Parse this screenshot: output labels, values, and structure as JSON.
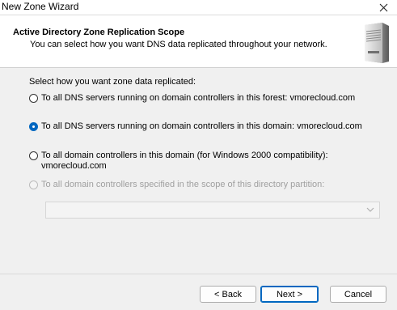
{
  "window": {
    "title": "New Zone Wizard"
  },
  "header": {
    "title": "Active Directory Zone Replication Scope",
    "subtitle": "You can select how you want DNS data replicated throughout your network.",
    "icon": "server-icon"
  },
  "body": {
    "prompt": "Select how you want zone data replicated:",
    "options": [
      {
        "label": "To all DNS servers running on domain controllers in this forest: vmorecloud.com",
        "selected": false,
        "enabled": true
      },
      {
        "label": "To all DNS servers running on domain controllers in this domain: vmorecloud.com",
        "selected": true,
        "enabled": true
      },
      {
        "label_line1": "To all domain controllers in this domain (for Windows 2000 compatibility):",
        "label_line2": "vmorecloud.com",
        "selected": false,
        "enabled": true
      },
      {
        "label": "To all domain controllers specified in the scope of this directory partition:",
        "selected": false,
        "enabled": false
      }
    ],
    "partition_select": {
      "value": "",
      "enabled": false
    }
  },
  "buttons": {
    "back": "< Back",
    "next": "Next >",
    "cancel": "Cancel"
  },
  "colors": {
    "accent": "#0067c0",
    "background": "#f0f0f0",
    "header": "#ffffff",
    "disabled_text": "#a0a0a0"
  }
}
